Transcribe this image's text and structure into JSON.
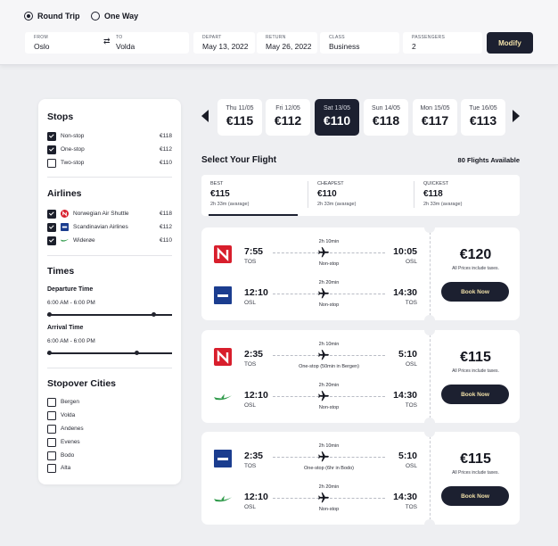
{
  "search": {
    "trip_types": [
      {
        "label": "Round Trip",
        "selected": true
      },
      {
        "label": "One Way",
        "selected": false
      }
    ],
    "from_label": "FROM",
    "from_value": "Oslo",
    "to_label": "TO",
    "to_value": "Volda",
    "depart_label": "DEPART",
    "depart_value": "May 13, 2022",
    "return_label": "RETURN",
    "return_value": "May 26, 2022",
    "class_label": "CLASS",
    "class_value": "Business",
    "passengers_label": "PASSENGERS",
    "passengers_value": "2",
    "modify_label": "Modify"
  },
  "filters": {
    "stops_title": "Stops",
    "stops": [
      {
        "label": "Non-stop",
        "price": "€118",
        "checked": true
      },
      {
        "label": "One-stop",
        "price": "€112",
        "checked": true
      },
      {
        "label": "Two-stop",
        "price": "€110",
        "checked": false
      }
    ],
    "airlines_title": "Airlines",
    "airlines": [
      {
        "label": "Norwegian Air Shuttle",
        "price": "€118",
        "checked": true,
        "logo": "norwegian-logo"
      },
      {
        "label": "Scandinavian Airlines",
        "price": "€112",
        "checked": true,
        "logo": "sas-logo"
      },
      {
        "label": "Widerøe",
        "price": "€110",
        "checked": true,
        "logo": "wideroe-logo"
      }
    ],
    "times_title": "Times",
    "departure_label": "Departure Time",
    "departure_range": "6:00 AM - 6:00 PM",
    "arrival_label": "Arrival Time",
    "arrival_range": "6:00 AM - 6:00 PM",
    "cities_title": "Stopover Cities",
    "cities": [
      {
        "label": "Bergen",
        "checked": false
      },
      {
        "label": "Volda",
        "checked": false
      },
      {
        "label": "Andenes",
        "checked": false
      },
      {
        "label": "Evenes",
        "checked": false
      },
      {
        "label": "Bodo",
        "checked": false
      },
      {
        "label": "Alta",
        "checked": false
      }
    ]
  },
  "dates": [
    {
      "label": "Thu 11/05",
      "price": "€115",
      "selected": false
    },
    {
      "label": "Fri 12/05",
      "price": "€112",
      "selected": false
    },
    {
      "label": "Sat 13/05",
      "price": "€110",
      "selected": true
    },
    {
      "label": "Sun 14/05",
      "price": "€118",
      "selected": false
    },
    {
      "label": "Mon 15/05",
      "price": "€117",
      "selected": false
    },
    {
      "label": "Tue 16/05",
      "price": "€113",
      "selected": false
    }
  ],
  "results": {
    "title": "Select Your Flight",
    "available": "80 Flights Available",
    "sort_tabs": [
      {
        "label": "BEST",
        "price": "€115",
        "sub": "2h 33m (avarage)",
        "active": true
      },
      {
        "label": "CHEAPEST",
        "price": "€110",
        "sub": "2h 33m (avarage)",
        "active": false
      },
      {
        "label": "QUICKEST",
        "price": "€118",
        "sub": "2h 33m (avarage)",
        "active": false
      }
    ],
    "flights": [
      {
        "price": "€120",
        "note": "All Prices include taxes.",
        "book_label": "Book Now",
        "segments": [
          {
            "logo": "norwegian-logo",
            "dep_time": "7:55",
            "dep_code": "TOS",
            "arr_time": "10:05",
            "arr_code": "OSL",
            "duration": "2h 10min",
            "stops": "Non-stop"
          },
          {
            "logo": "sas-logo",
            "dep_time": "12:10",
            "dep_code": "OSL",
            "arr_time": "14:30",
            "arr_code": "TOS",
            "duration": "2h 20min",
            "stops": "Non-stop"
          }
        ]
      },
      {
        "price": "€115",
        "note": "All Prices include taxes.",
        "book_label": "Book Now",
        "segments": [
          {
            "logo": "norwegian-logo",
            "dep_time": "2:35",
            "dep_code": "TOS",
            "arr_time": "5:10",
            "arr_code": "OSL",
            "duration": "2h 10min",
            "stops": "One-stop (50min in Bergen)"
          },
          {
            "logo": "wideroe-logo",
            "dep_time": "12:10",
            "dep_code": "OSL",
            "arr_time": "14:30",
            "arr_code": "TOS",
            "duration": "2h 20min",
            "stops": "Non-stop"
          }
        ]
      },
      {
        "price": "€115",
        "note": "All Prices include taxes.",
        "book_label": "Book Now",
        "segments": [
          {
            "logo": "sas-logo",
            "dep_time": "2:35",
            "dep_code": "TOS",
            "arr_time": "5:10",
            "arr_code": "OSL",
            "duration": "2h 10min",
            "stops": "One-stop (6hr in Bodo)"
          },
          {
            "logo": "wideroe-logo",
            "dep_time": "12:10",
            "dep_code": "OSL",
            "arr_time": "14:30",
            "arr_code": "TOS",
            "duration": "2h 20min",
            "stops": "Non-stop"
          }
        ]
      }
    ]
  },
  "colors": {
    "accent_dark": "#1c2030",
    "button_text": "#f1e0a8",
    "norwegian_red": "#d81e2c",
    "sas_blue": "#1b3d8f",
    "wideroe_green": "#2f9a4a"
  }
}
